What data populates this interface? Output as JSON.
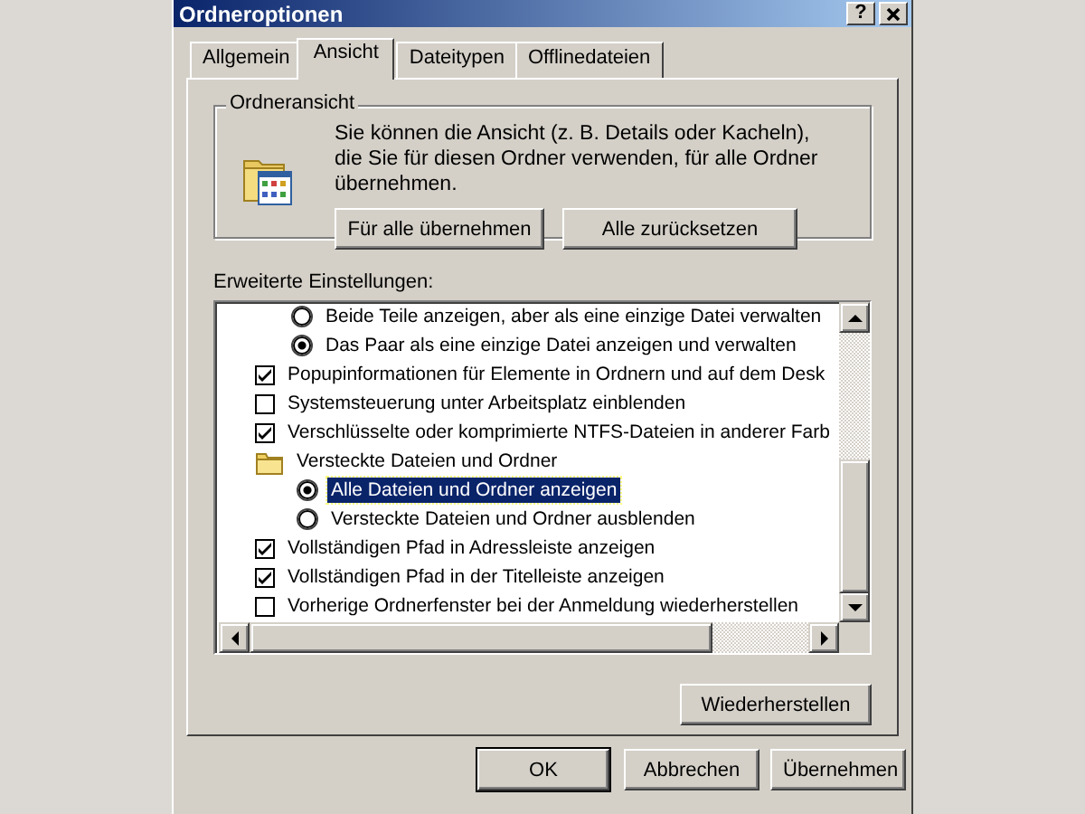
{
  "window": {
    "title": "Ordneroptionen",
    "help": "?"
  },
  "tabs": [
    {
      "label": "Allgemein",
      "selected": false
    },
    {
      "label": "Ansicht",
      "selected": true
    },
    {
      "label": "Dateitypen",
      "selected": false
    },
    {
      "label": "Offlinedateien",
      "selected": false
    }
  ],
  "folder_view": {
    "title": "Ordneransicht",
    "text": "Sie können die Ansicht (z. B. Details oder Kacheln), die Sie für diesen Ordner verwenden, für alle Ordner übernehmen.",
    "buttons": [
      "Für alle übernehmen",
      "Alle zurücksetzen"
    ]
  },
  "advanced": {
    "label": "Erweiterte Einstellungen:",
    "items": [
      {
        "kind": "radio",
        "label": "Beide Teile anzeigen, aber als eine einzige Datei verwalten",
        "checked": false,
        "selected": false
      },
      {
        "kind": "radio",
        "label": "Das Paar als eine einzige Datei anzeigen und verwalten",
        "checked": true,
        "selected": false
      },
      {
        "kind": "checkbox",
        "label": "Popupinformationen für Elemente in Ordnern und auf dem Desk",
        "checked": true,
        "selected": false
      },
      {
        "kind": "checkbox",
        "label": "Systemsteuerung unter Arbeitsplatz einblenden",
        "checked": false,
        "selected": false
      },
      {
        "kind": "checkbox",
        "label": "Verschlüsselte oder komprimierte NTFS-Dateien in anderer Farb",
        "checked": true,
        "selected": false
      },
      {
        "kind": "folder",
        "label": "Versteckte Dateien und Ordner",
        "selected": false,
        "children": [
          {
            "kind": "radio",
            "label": "Alle Dateien und Ordner anzeigen",
            "checked": true,
            "selected": true
          },
          {
            "kind": "radio",
            "label": "Versteckte Dateien und Ordner ausblenden",
            "checked": false,
            "selected": false
          }
        ]
      },
      {
        "kind": "checkbox",
        "label": "Vollständigen Pfad in Adressleiste anzeigen",
        "checked": true,
        "selected": false
      },
      {
        "kind": "checkbox",
        "label": "Vollständigen Pfad in der Titelleiste anzeigen",
        "checked": true,
        "selected": false
      },
      {
        "kind": "checkbox",
        "label": "Vorherige Ordnerfenster bei der Anmeldung wiederherstellen",
        "checked": false,
        "selected": false
      }
    ],
    "restore_button": "Wiederherstellen"
  },
  "buttons": [
    {
      "label": "OK",
      "default": true
    },
    {
      "label": "Abbrechen",
      "default": false
    },
    {
      "label": "Übernehmen",
      "default": false
    }
  ]
}
